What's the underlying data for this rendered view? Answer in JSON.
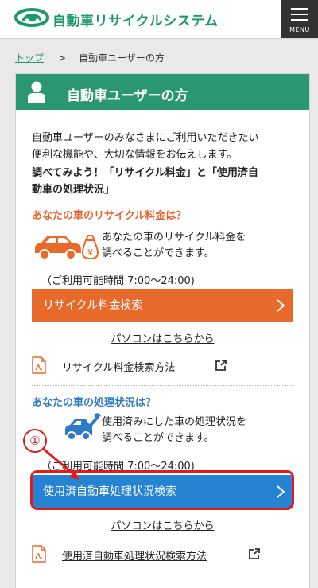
{
  "header": {
    "site_title": "自動車リサイクルシステム",
    "menu_label": "MENU"
  },
  "breadcrumb": {
    "home": "トップ",
    "separator": ">",
    "current": "自動車ユーザーの方"
  },
  "card": {
    "title": "自動車ユーザーの方",
    "intro_line1": "自動車ユーザーのみなさまにご利用いただきたい",
    "intro_line2": "便利な機能や、大切な情報をお伝えします。",
    "bold_line1": "調べてみよう！「リサイクル料金」と「使用済自",
    "bold_line2": "動車の処理状況」"
  },
  "recycle_fee": {
    "heading": "あなたの車のリサイクル料金は？",
    "desc_line1": "あなたの車のリサイクル料金を",
    "desc_line2": "調べることができます。",
    "hours": "（ご利用可能時間 7:00〜24:00)",
    "button_label": "リサイクル料金検索",
    "pc_link": "パソコンはこちらから",
    "howto_link": "リサイクル料金検索方法"
  },
  "processing_status": {
    "heading": "あなたの車の処理状況は？",
    "desc_line1": "使用済みにした車の処理状況を",
    "desc_line2": "調べることができます。",
    "hours": "（ご利用可能時間 7:00〜24:00)",
    "button_label": "使用済自動車処理状況検索",
    "pc_link": "パソコンはこちらから",
    "howto_link": "使用済自動車処理状況検索方法"
  },
  "annotation": {
    "marker": "①",
    "color": "#e41a1a"
  },
  "colors": {
    "brand_green": "#2a9770",
    "orange": "#e86a2b",
    "blue": "#2483d2"
  },
  "icons": {
    "logo": "car-logo-icon",
    "user": "user-icon",
    "car_fee": "car-money-icon",
    "car_tool": "car-wrench-icon",
    "pdf": "pdf-icon",
    "external": "external-link-icon",
    "chevron": "chevron-right-icon"
  }
}
